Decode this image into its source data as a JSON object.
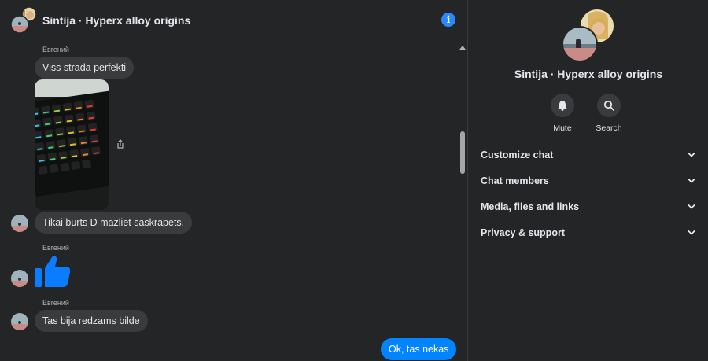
{
  "header": {
    "title": "Sintija · Hyperx alloy origins",
    "info_icon": "info-icon"
  },
  "messages": [
    {
      "sender": "Евгений",
      "text": "Viss strāda perfekti"
    },
    {
      "text": "Tikai burts D mazliet saskrāpēts."
    },
    {
      "sender": "Евгений",
      "emoji": "thumbs-up-icon"
    },
    {
      "sender": "Евгений",
      "text": "Tas bija redzams bilde"
    },
    {
      "text": "Ok, tas nekas",
      "from_me": true
    }
  ],
  "panel": {
    "title": "Sintija · Hyperx alloy origins",
    "actions": [
      {
        "label": "Mute",
        "icon": "bell-icon"
      },
      {
        "label": "Search",
        "icon": "search-icon"
      }
    ],
    "sections": [
      {
        "label": "Customize chat"
      },
      {
        "label": "Chat members"
      },
      {
        "label": "Media, files and links"
      },
      {
        "label": "Privacy & support"
      }
    ]
  },
  "colors": {
    "background": "#242526",
    "bubble": "#3a3b3c",
    "accent": "#0084ff"
  }
}
